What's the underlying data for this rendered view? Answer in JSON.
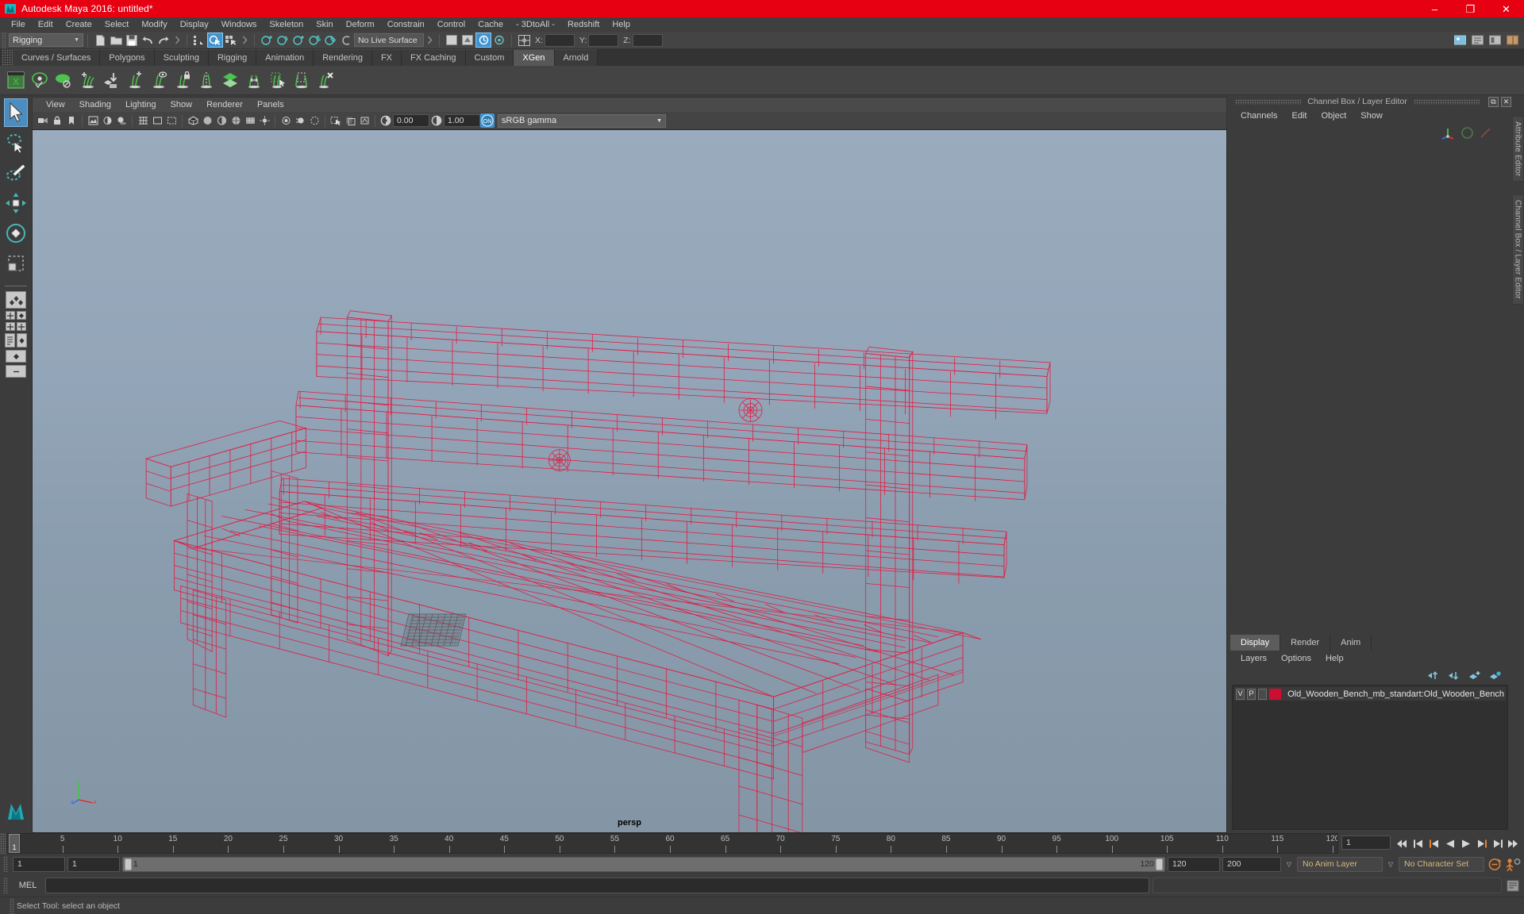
{
  "window": {
    "title": "Autodesk Maya 2016: untitled*",
    "logo_icon": "maya-app-icon",
    "minimize_label": "–",
    "maximize_label": "❐",
    "close_label": "✕",
    "titlebar_color": "#e60012"
  },
  "menubar": {
    "items": [
      "File",
      "Edit",
      "Create",
      "Select",
      "Modify",
      "Display",
      "Windows",
      "Skeleton",
      "Skin",
      "Deform",
      "Constrain",
      "Control",
      "Cache",
      "- 3DtoAll -",
      "Redshift",
      "Help"
    ]
  },
  "statusline": {
    "menuset_value": "Rigging",
    "menuset_arrow": "▼",
    "live_surface_value": "No Live Surface",
    "coords": {
      "x_label": "X:",
      "y_label": "Y:",
      "z_label": "Z:",
      "x_value": "",
      "y_value": "",
      "z_value": ""
    },
    "icons": [
      "new-scene-icon",
      "open-scene-icon",
      "save-scene-icon",
      "undo-icon",
      "redo-icon",
      "select-hierarchy-icon",
      "select-object-icon",
      "select-component-icon",
      "snap-grid-icon",
      "snap-curve-icon",
      "snap-point-icon",
      "snap-projected-center-icon",
      "snap-view-plane-icon",
      "make-live-icon",
      "show-manipulator-icon",
      "absolute-relative-icon"
    ],
    "right_icons": [
      "render-view-icon",
      "attribute-editor-icon",
      "tool-settings-icon",
      "channel-box-icon"
    ]
  },
  "shelf": {
    "tabs": [
      "Curves / Surfaces",
      "Polygons",
      "Sculpting",
      "Rigging",
      "Animation",
      "Rendering",
      "FX",
      "FX Caching",
      "Custom",
      "XGen",
      "Arnold"
    ],
    "selected_tab": "XGen",
    "icons": [
      "xgen-window-icon",
      "xgen-preview-icon",
      "xgen-leaf-icon",
      "xgen-add-description-icon",
      "xgen-import-collection-icon",
      "xgen-add-guide-icon",
      "xgen-guide-visibility-icon",
      "xgen-lock-guide-icon",
      "xgen-mirror-guide-icon",
      "xgen-layer-icon",
      "xgen-move-guide-icon",
      "xgen-select-guide-icon",
      "xgen-region-icon",
      "xgen-delete-guide-icon"
    ]
  },
  "toolbox": {
    "tools": [
      {
        "name": "select-tool",
        "icon": "arrow-cursor-icon",
        "selected": true
      },
      {
        "name": "lasso-tool",
        "icon": "lasso-icon",
        "selected": false
      },
      {
        "name": "paint-selection-tool",
        "icon": "paint-brush-icon",
        "selected": false
      },
      {
        "name": "move-tool",
        "icon": "move-arrows-icon",
        "selected": false
      },
      {
        "name": "rotate-tool",
        "icon": "rotate-ring-icon",
        "selected": false
      },
      {
        "name": "scale-tool",
        "icon": "scale-box-icon",
        "selected": false
      }
    ],
    "layouts": [
      "single-perspective-layout",
      "four-view-layout",
      "two-pane-layout",
      "outliner-persp-layout",
      "hypergraph-layout",
      "persp-graph-layout",
      "minimize-layout"
    ],
    "maya_logo_icon": "maya-logo-icon"
  },
  "viewport": {
    "panel_menu": [
      "View",
      "Shading",
      "Lighting",
      "Show",
      "Renderer",
      "Panels"
    ],
    "camera_label": "persp",
    "toolbar": {
      "exposure_value": "0.00",
      "gamma_value": "1.00",
      "color_toggle_label": "ON",
      "color_profile": "sRGB gamma",
      "dropdown_arrow": "▼",
      "icons": [
        "select-camera-icon",
        "lock-camera-icon",
        "bookmark-icon",
        "image-plane-icon",
        "two-sided-lighting-icon",
        "shadows-icon",
        "grid-icon",
        "wireframe-shaded-icon",
        "smooth-shade-icon",
        "textured-icon",
        "screen-space-ao-icon",
        "motion-blur-icon",
        "multisample-icon",
        "isolate-select-icon",
        "xray-icon",
        "exposure-icon",
        "contrast-icon"
      ]
    },
    "axis_gizmo": {
      "y_label": "y",
      "x_label": "x",
      "z_label": "z"
    },
    "model_name": "Old_Wooden_Bench",
    "wireframe_color": "#e8143c",
    "background_top": "#9aabbd",
    "background_bottom": "#8496a6"
  },
  "channelbox": {
    "panel_title": "Channel Box / Layer Editor",
    "undock_label": "⧉",
    "close_label": "✕",
    "menus": [
      "Channels",
      "Edit",
      "Object",
      "Show"
    ],
    "empty": ""
  },
  "sidetabs": {
    "items": [
      "Attribute Editor",
      "Channel Box / Layer Editor"
    ]
  },
  "layereditor": {
    "tabs": [
      "Display",
      "Render",
      "Anim"
    ],
    "selected_tab": "Display",
    "menus": [
      "Layers",
      "Options",
      "Help"
    ],
    "toolbar_icons": [
      "move-layer-up-icon",
      "move-layer-down-icon",
      "new-layer-icon",
      "new-layer-from-selected-icon"
    ],
    "layers": [
      {
        "visibility": "V",
        "playback": "P",
        "shading": "",
        "color": "#cc0e30",
        "name": "Old_Wooden_Bench_mb_standart:Old_Wooden_Bench"
      }
    ]
  },
  "timeslider": {
    "current_frame": "1",
    "frame_field_value": "1",
    "start": 1,
    "end": 120,
    "tick_labels": [
      5,
      10,
      15,
      20,
      25,
      30,
      35,
      40,
      45,
      50,
      55,
      60,
      65,
      70,
      75,
      80,
      85,
      90,
      95,
      100,
      105,
      110,
      115,
      120
    ],
    "transport": [
      "go-to-start-icon",
      "step-back-key-icon",
      "step-back-frame-icon",
      "play-backwards-icon",
      "play-forwards-icon",
      "step-forward-frame-icon",
      "step-forward-key-icon",
      "go-to-end-icon"
    ]
  },
  "rangebar": {
    "anim_start": "1",
    "playback_start": "1",
    "range_start_label": "1",
    "range_end_label": "120",
    "playback_end": "120",
    "anim_end": "200",
    "anim_layer": "No Anim Layer",
    "character_set": "No Character Set",
    "dropdown_arrow": "▽",
    "auto_key_icon": "auto-keyframe-icon",
    "anim_prefs_icon": "animation-preferences-icon"
  },
  "commandline": {
    "label": "MEL",
    "input_value": "",
    "input_placeholder": "",
    "output_value": "",
    "script_editor_icon": "script-editor-icon"
  },
  "helpline": {
    "text": "Select Tool: select an object"
  }
}
